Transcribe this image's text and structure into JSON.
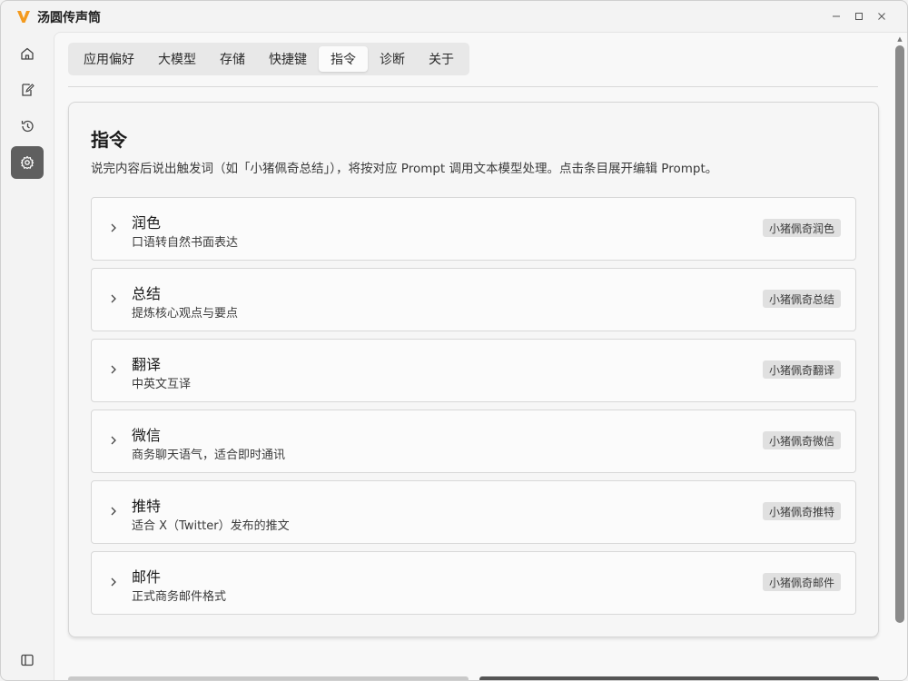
{
  "app": {
    "title": "汤圆传声筒",
    "logo_icon": "v-logo-icon",
    "accent": "#f39a1e"
  },
  "window_controls": [
    "minimize-icon",
    "maximize-icon",
    "close-icon"
  ],
  "sidebar": {
    "items": [
      {
        "name": "home",
        "icon": "home-icon",
        "active": false
      },
      {
        "name": "notes",
        "icon": "edit-note-icon",
        "active": false
      },
      {
        "name": "history",
        "icon": "history-icon",
        "active": false
      },
      {
        "name": "settings",
        "icon": "gear-icon",
        "active": true
      }
    ],
    "bottom_icon": "sidebar-toggle-icon"
  },
  "tabs": [
    {
      "label": "应用偏好",
      "active": false
    },
    {
      "label": "大模型",
      "active": false
    },
    {
      "label": "存储",
      "active": false
    },
    {
      "label": "快捷键",
      "active": false
    },
    {
      "label": "指令",
      "active": true
    },
    {
      "label": "诊断",
      "active": false
    },
    {
      "label": "关于",
      "active": false
    }
  ],
  "section": {
    "title": "指令",
    "description": "说完内容后说出触发词（如「小猪佩奇总结」），将按对应 Prompt 调用文本模型处理。点击条目展开编辑 Prompt。"
  },
  "commands": [
    {
      "name": "润色",
      "subtitle": "口语转自然书面表达",
      "trigger": "小猪佩奇润色"
    },
    {
      "name": "总结",
      "subtitle": "提炼核心观点与要点",
      "trigger": "小猪佩奇总结"
    },
    {
      "name": "翻译",
      "subtitle": "中英文互译",
      "trigger": "小猪佩奇翻译"
    },
    {
      "name": "微信",
      "subtitle": "商务聊天语气，适合即时通讯",
      "trigger": "小猪佩奇微信"
    },
    {
      "name": "推特",
      "subtitle": "适合 X（Twitter）发布的推文",
      "trigger": "小猪佩奇推特"
    },
    {
      "name": "邮件",
      "subtitle": "正式商务邮件格式",
      "trigger": "小猪佩奇邮件"
    }
  ]
}
